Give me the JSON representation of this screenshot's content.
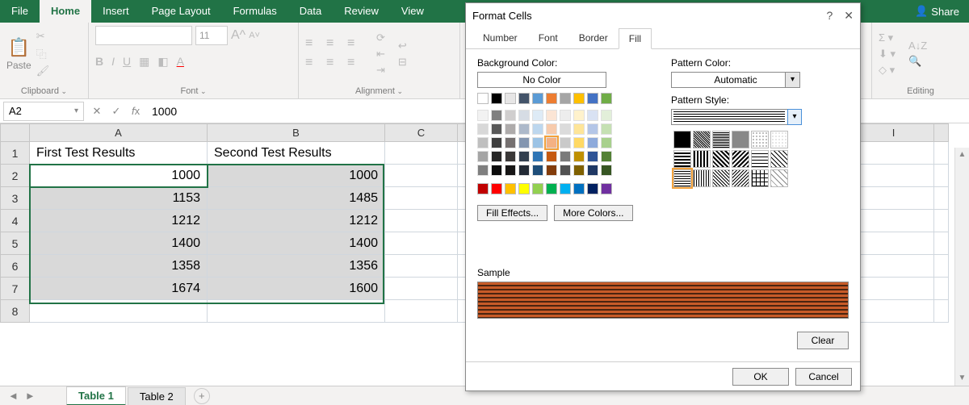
{
  "ribbon": {
    "tabs": [
      "File",
      "Home",
      "Insert",
      "Page Layout",
      "Formulas",
      "Data",
      "Review",
      "View"
    ],
    "active_tab": "Home",
    "share": "Share"
  },
  "groups": {
    "clipboard": {
      "paste": "Paste",
      "label": "Clipboard"
    },
    "font": {
      "size": "11",
      "label": "Font"
    },
    "alignment": {
      "label": "Alignment"
    },
    "editing": {
      "label": "Editing"
    }
  },
  "namebox": "A2",
  "formula_value": "1000",
  "columns": [
    "A",
    "B",
    "C",
    "I"
  ],
  "rows": [
    "1",
    "2",
    "3",
    "4",
    "5",
    "6",
    "7",
    "8"
  ],
  "table": {
    "headers": [
      "First Test Results",
      "Second Test Results"
    ],
    "data": [
      [
        1000,
        1000
      ],
      [
        1153,
        1485
      ],
      [
        1212,
        1212
      ],
      [
        1400,
        1400
      ],
      [
        1358,
        1356
      ],
      [
        1674,
        1600
      ]
    ]
  },
  "sheet_tabs": {
    "active": "Table 1",
    "other": "Table 2"
  },
  "dialog": {
    "title": "Format Cells",
    "tabs": [
      "Number",
      "Font",
      "Border",
      "Fill"
    ],
    "active_tab": "Fill",
    "bg_label": "Background Color:",
    "nocolor": "No Color",
    "fill_effects": "Fill Effects...",
    "more_colors": "More Colors...",
    "pattern_color_label": "Pattern Color:",
    "pattern_color": "Automatic",
    "pattern_style_label": "Pattern Style:",
    "sample": "Sample",
    "clear": "Clear",
    "ok": "OK",
    "cancel": "Cancel"
  },
  "theme_swatches_row1": [
    "#ffffff",
    "#000000",
    "#e7e6e6",
    "#44546a",
    "#5b9bd5",
    "#ed7d31",
    "#a5a5a5",
    "#ffc000",
    "#4472c4",
    "#70ad47"
  ],
  "theme_shades": [
    [
      "#f2f2f2",
      "#808080",
      "#d0cece",
      "#d6dce4",
      "#deebf6",
      "#fbe5d5",
      "#ededed",
      "#fff2cc",
      "#d9e2f3",
      "#e2efd9"
    ],
    [
      "#d8d8d8",
      "#595959",
      "#aeabab",
      "#adb9ca",
      "#bdd7ee",
      "#f7cbac",
      "#dbdbdb",
      "#fee599",
      "#b4c6e7",
      "#c5e0b3"
    ],
    [
      "#bfbfbf",
      "#3f3f3f",
      "#757070",
      "#8496b0",
      "#9cc3e5",
      "#f4b183",
      "#c9c9c9",
      "#ffd965",
      "#8eaadb",
      "#a8d08d"
    ],
    [
      "#a5a5a5",
      "#262626",
      "#3a3838",
      "#323f4f",
      "#2e75b5",
      "#c55a11",
      "#7b7b7b",
      "#bf9000",
      "#2f5496",
      "#538135"
    ],
    [
      "#7f7f7f",
      "#0c0c0c",
      "#171616",
      "#222a35",
      "#1e4e79",
      "#833c0b",
      "#525252",
      "#7f6000",
      "#1f3864",
      "#375623"
    ]
  ],
  "standard_swatches": [
    "#c00000",
    "#ff0000",
    "#ffc000",
    "#ffff00",
    "#92d050",
    "#00b050",
    "#00b0f0",
    "#0070c0",
    "#002060",
    "#7030a0"
  ]
}
